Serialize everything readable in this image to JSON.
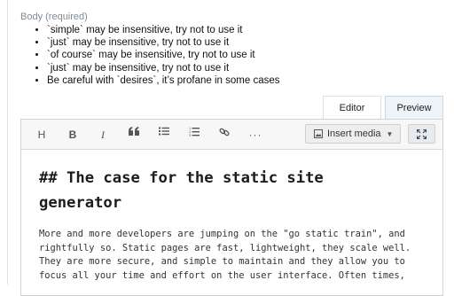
{
  "field": {
    "label": "Body (required)"
  },
  "warnings": [
    "`simple` may be insensitive, try not to use it",
    "`just` may be insensitive, try not to use it",
    "`of course` may be insensitive, try not to use it",
    "`just` may be insensitive, try not to use it",
    "Be careful with `desires`, it’s profane in some cases"
  ],
  "tabs": {
    "editor": "Editor",
    "preview": "Preview"
  },
  "toolbar": {
    "heading": "H",
    "bold": "B",
    "italic": "I",
    "more": "···",
    "insert_media": "Insert media",
    "icons": [
      "heading-icon",
      "bold-icon",
      "italic-icon",
      "quote-icon",
      "bullet-list-icon",
      "numbered-list-icon",
      "link-icon",
      "more-icon",
      "image-icon",
      "chevron-down-icon",
      "fullscreen-icon"
    ]
  },
  "editor": {
    "heading": "## The case for the static site generator",
    "paragraph": "More and more developers are jumping on the \"go static train\", and rightfully so. Static pages are fast, lightweight, they scale well. They are more secure, and simple to maintain and they allow you to focus all your time and effort on the user interface. Often times,"
  },
  "colors": {
    "label": "#7f8b96",
    "toolbar_bg": "#f7f7f7",
    "preview_tab_bg": "#eef4f7",
    "border": "#d3d3d3"
  }
}
